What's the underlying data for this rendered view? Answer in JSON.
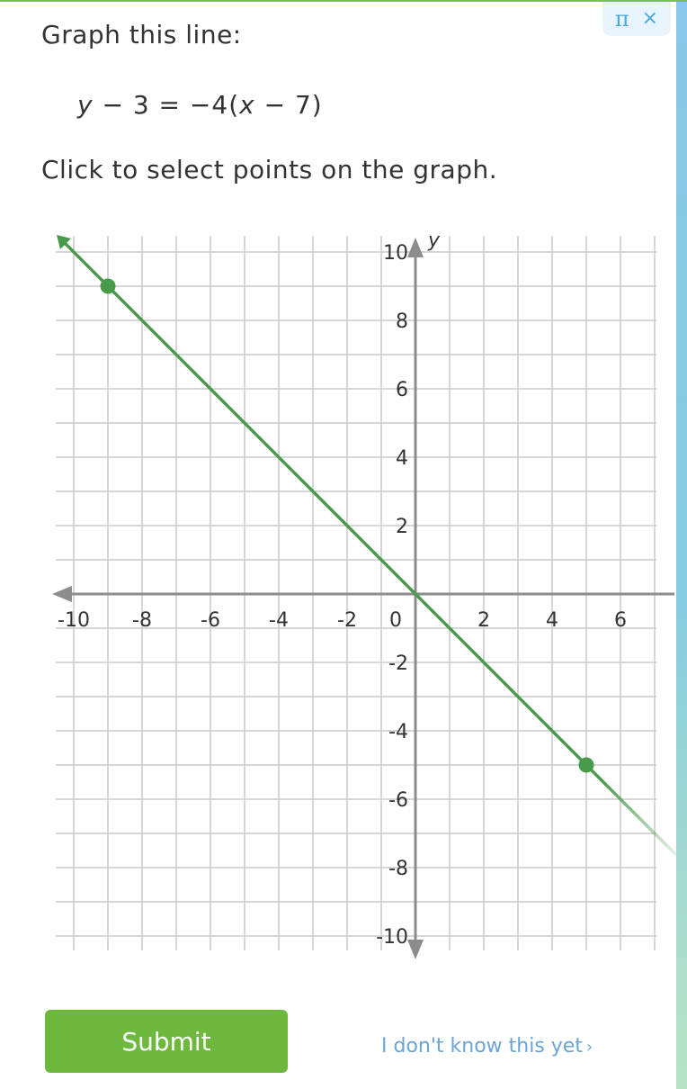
{
  "tools": {
    "pi_symbol": "π",
    "close_symbol": "×"
  },
  "question": {
    "prompt": "Graph this line:",
    "equation": {
      "y": "y",
      "left_rest": " − 3 = −4(",
      "x": "x",
      "right_rest": " − 7)"
    },
    "instruction": "Click to select points on the graph."
  },
  "chart_data": {
    "type": "line",
    "xlim": [
      -10,
      7
    ],
    "ylim": [
      -10,
      10
    ],
    "grid": true,
    "xlabel": "",
    "ylabel": "y",
    "x_ticks": [
      -10,
      -8,
      -6,
      -4,
      -2,
      0,
      2,
      4,
      6
    ],
    "x_tick_labels": [
      "-10",
      "-8",
      "-6",
      "-4",
      "-2",
      "0",
      "2",
      "4",
      "6"
    ],
    "y_ticks": [
      10,
      8,
      6,
      4,
      2,
      -2,
      -4,
      -6,
      -8,
      -10
    ],
    "y_tick_labels": [
      "10",
      "8",
      "6",
      "4",
      "2",
      "-2",
      "-4",
      "-6",
      "-8",
      "-10"
    ],
    "line": {
      "color": "#4a9a4c",
      "from": [
        -10.5,
        10.5
      ],
      "to": [
        7.6,
        -7.6
      ]
    },
    "points": [
      {
        "x": -9,
        "y": 9
      },
      {
        "x": 5,
        "y": -5
      }
    ]
  },
  "actions": {
    "submit_label": "Submit",
    "dont_know_label": "I don't know this yet",
    "dont_know_chevron": "›"
  },
  "colors": {
    "accent": "#6eb83e",
    "link": "#6aa4d8",
    "line": "#4a9a4c"
  }
}
